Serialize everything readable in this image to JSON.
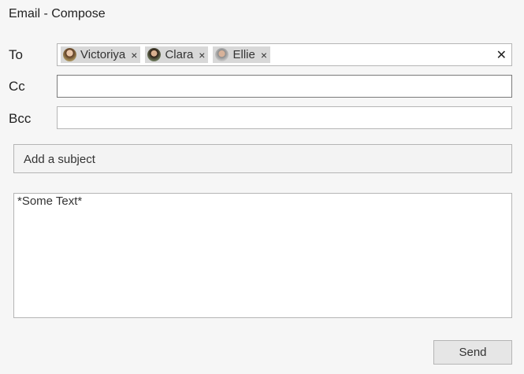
{
  "window": {
    "title": "Email - Compose"
  },
  "to": {
    "label": "To",
    "recipients": [
      {
        "name": "Victoriya",
        "remove_icon": "close-icon"
      },
      {
        "name": "Clara",
        "remove_icon": "close-icon"
      },
      {
        "name": "Ellie",
        "remove_icon": "close-icon"
      }
    ],
    "remove_glyph": "×",
    "clear_glyph": "✕"
  },
  "cc": {
    "label": "Cc",
    "value": ""
  },
  "bcc": {
    "label": "Bcc",
    "value": ""
  },
  "subject": {
    "placeholder": "Add a subject"
  },
  "body": {
    "text": "*Some Text*"
  },
  "actions": {
    "send_label": "Send"
  }
}
